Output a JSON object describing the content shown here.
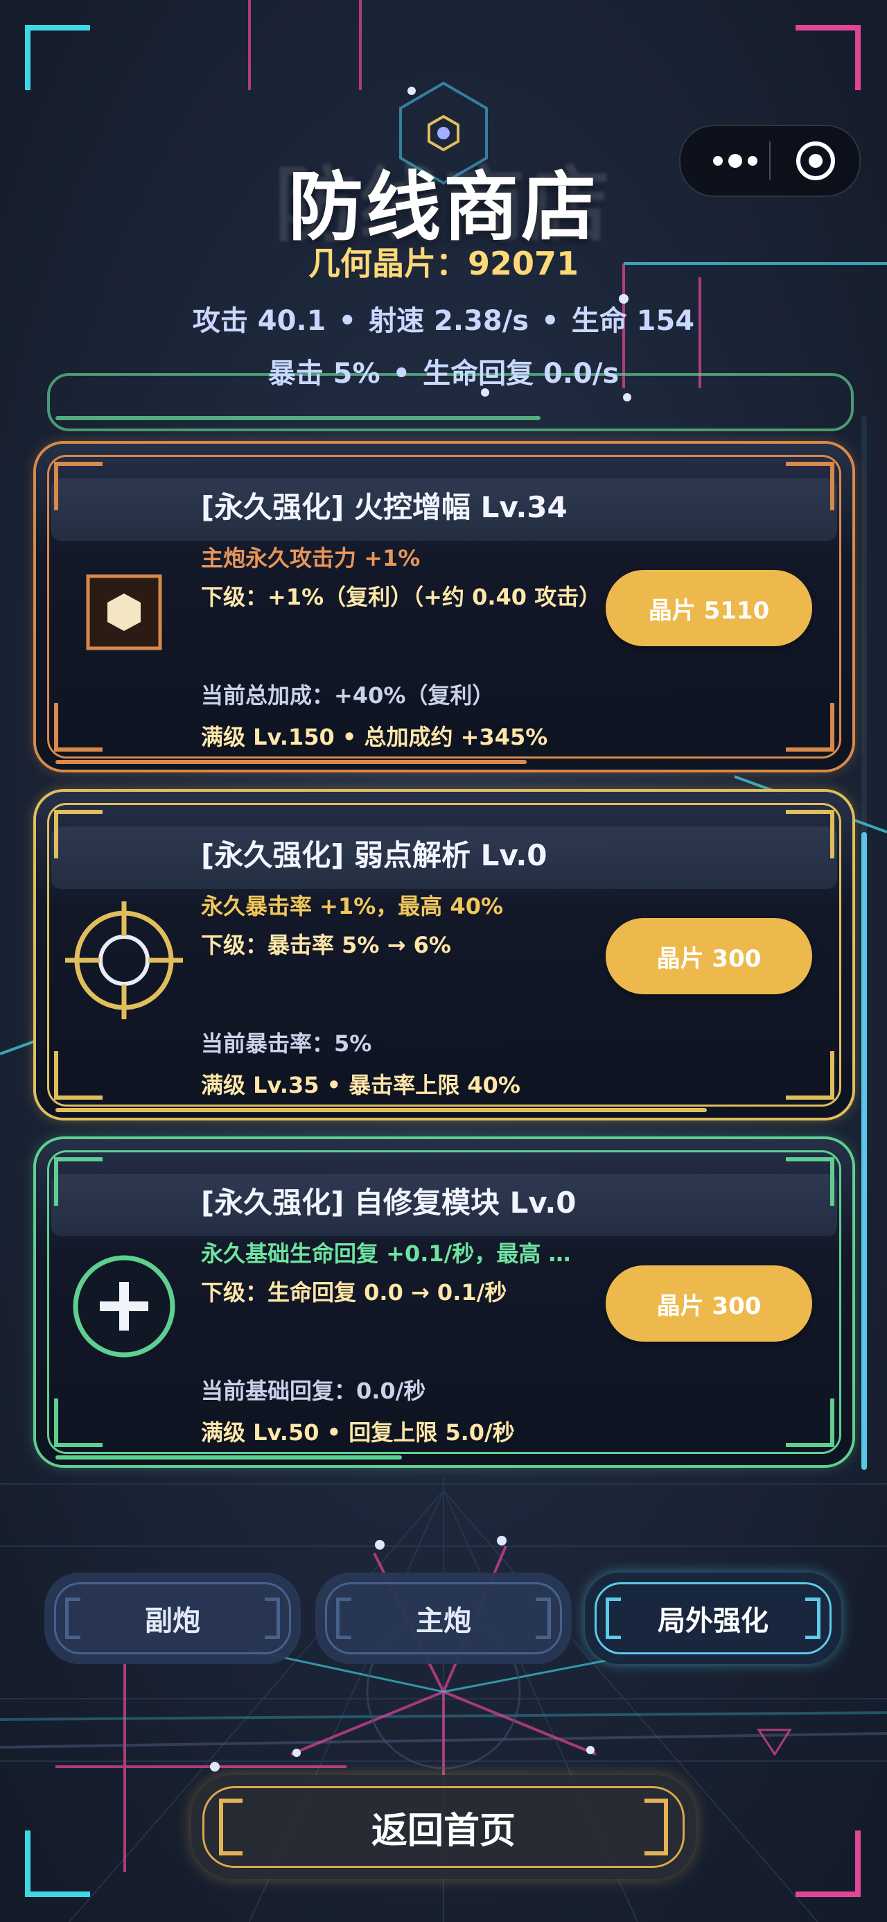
{
  "header": {
    "title": "防线商店",
    "crystals_label": "几何晶片：92071",
    "stats_line1": [
      "攻击 40.1",
      "射速 2.38/s",
      "生命 154"
    ],
    "stats_line2": [
      "暴击 5%",
      "生命回复 0.0/s"
    ],
    "separator": "•"
  },
  "upgrades": [
    {
      "name": "[永久强化] 火控增幅  Lv.34",
      "desc": "主炮永久攻击力 +1%",
      "next": "下级：+1%（复利）（+约 0.40 攻击）",
      "current": "当前总加成：+40%（复利）",
      "max": "满级 Lv.150 • 总加成约 +345%",
      "price": "晶片 5110",
      "icon": "hexagon-icon",
      "color": "#d9894a",
      "desc_color": "#e8955a"
    },
    {
      "name": "[永久强化] 弱点解析  Lv.0",
      "desc": "永久暴击率 +1%，最高 40%",
      "next": "下级：暴击率 5% → 6%",
      "current": "当前暴击率：5%",
      "max": "满级 Lv.35 • 暴击率上限 40%",
      "price": "晶片 300",
      "icon": "crosshair-icon",
      "color": "#e0be5c",
      "desc_color": "#f1c75a"
    },
    {
      "name": "[永久强化] 自修复模块  Lv.0",
      "desc": "永久基础生命回复 +0.1/秒，最高 …",
      "next": "下级：生命回复 0.0 → 0.1/秒",
      "current": "当前基础回复：0.0/秒",
      "max": "满级 Lv.50 • 回复上限 5.0/秒",
      "price": "晶片 300",
      "icon": "plus-icon",
      "color": "#5fcf90",
      "desc_color": "#6fe3a0"
    }
  ],
  "tabs": [
    {
      "label": "副炮",
      "active": false
    },
    {
      "label": "主炮",
      "active": false
    },
    {
      "label": "局外强化",
      "active": true
    }
  ],
  "home_button": "返回首页"
}
